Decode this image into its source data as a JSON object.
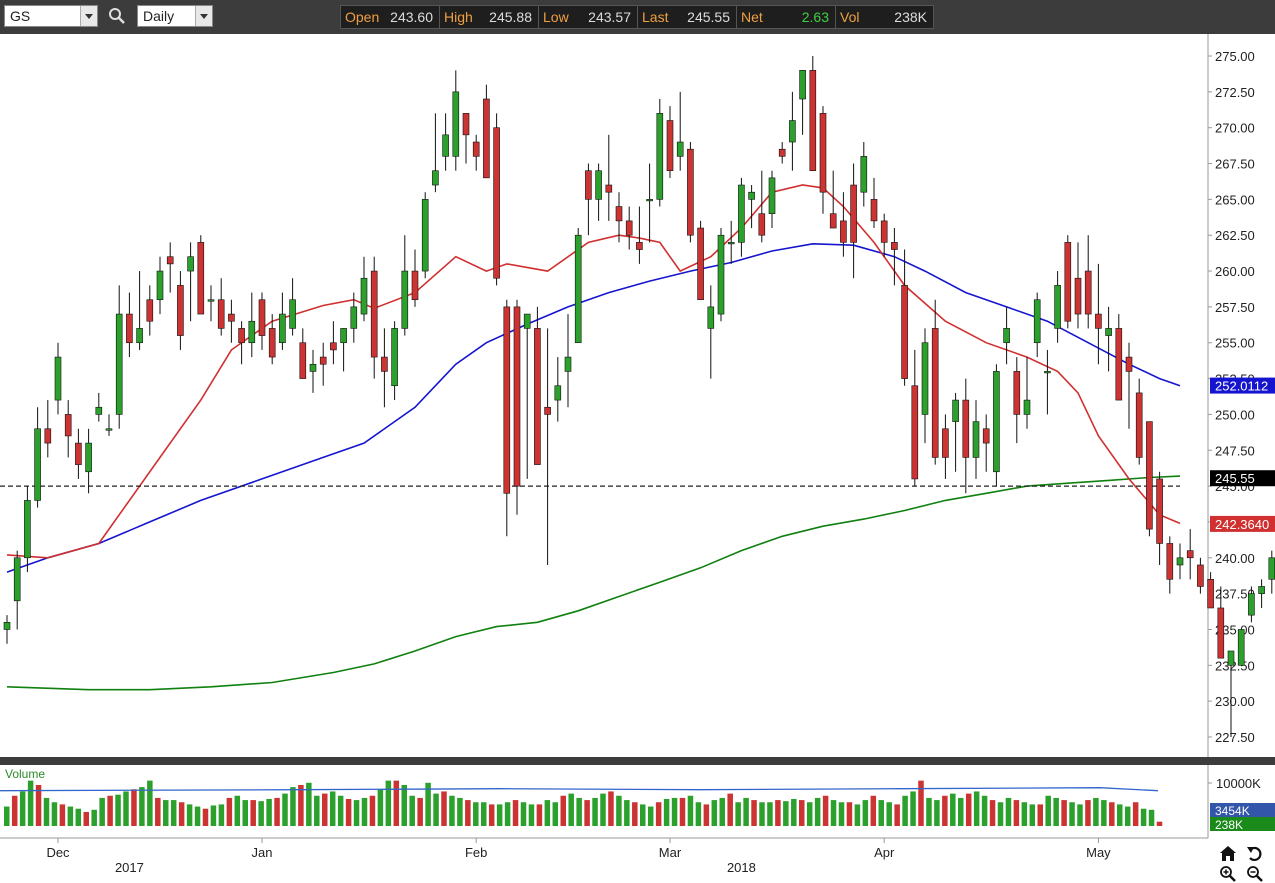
{
  "toolbar": {
    "symbol": "GS",
    "interval": "Daily"
  },
  "quote": {
    "open_label": "Open",
    "open": "243.60",
    "high_label": "High",
    "high": "245.88",
    "low_label": "Low",
    "low": "243.57",
    "last_label": "Last",
    "last": "245.55",
    "net_label": "Net",
    "net": "2.63",
    "vol_label": "Vol",
    "vol": "238K"
  },
  "colors": {
    "up": "#2ca02c",
    "down": "#cc3333",
    "ma_short": "#d03030",
    "ma_mid": "#1515d0",
    "ma_long": "#108010"
  },
  "price_panel": {
    "last_marker": "245.55",
    "ma_blue_marker": "252.0112",
    "ma_red_marker": "242.3640",
    "reference_line": 245.0
  },
  "volume_panel": {
    "title": "Volume",
    "ticks": [
      "10000K"
    ],
    "ma_marker": "3454K",
    "last_marker": "238K"
  },
  "chart_data": {
    "type": "candlestick",
    "y_ticks": [
      "227.50",
      "230.00",
      "232.50",
      "235.00",
      "237.50",
      "240.00",
      "242.50",
      "245.00",
      "247.50",
      "250.00",
      "252.50",
      "255.00",
      "257.50",
      "260.00",
      "262.50",
      "265.00",
      "267.50",
      "270.00",
      "272.50",
      "275.00"
    ],
    "ylim": [
      226,
      276.3
    ],
    "month_labels": [
      {
        "label": "Dec",
        "index": 5
      },
      {
        "label": "Jan",
        "index": 25
      },
      {
        "label": "Feb",
        "index": 46
      },
      {
        "label": "Mar",
        "index": 65
      },
      {
        "label": "Apr",
        "index": 86
      },
      {
        "label": "May",
        "index": 107
      }
    ],
    "year_labels": [
      {
        "label": "2017",
        "index": 12
      },
      {
        "label": "2018",
        "index": 72
      }
    ],
    "candles": [
      [
        235.0,
        236.0,
        234.0,
        235.5
      ],
      [
        237.0,
        240.5,
        235.0,
        240.0
      ],
      [
        240.0,
        245.0,
        239.0,
        244.0
      ],
      [
        244.0,
        250.5,
        243.5,
        249.0
      ],
      [
        249.0,
        251.0,
        247.0,
        248.0
      ],
      [
        251.0,
        255.0,
        250.0,
        254.0
      ],
      [
        250.0,
        251.0,
        247.0,
        248.5
      ],
      [
        248.0,
        249.0,
        245.5,
        246.5
      ],
      [
        246.0,
        249.0,
        244.5,
        248.0
      ],
      [
        250.0,
        251.5,
        249.5,
        250.5
      ],
      [
        249.0,
        250.0,
        248.5,
        249.0
      ],
      [
        250.0,
        259.0,
        249.0,
        257.0
      ],
      [
        257.0,
        258.5,
        254.0,
        255.0
      ],
      [
        255.0,
        260.0,
        254.5,
        256.0
      ],
      [
        258.0,
        259.0,
        255.5,
        256.5
      ],
      [
        258.0,
        261.0,
        257.0,
        260.0
      ],
      [
        261.0,
        262.0,
        258.5,
        260.5
      ],
      [
        259.0,
        260.0,
        254.5,
        255.5
      ],
      [
        260.0,
        262.0,
        256.5,
        261.0
      ],
      [
        262.0,
        262.5,
        258.0,
        257.0
      ],
      [
        258.0,
        259.0,
        256.5,
        258.0
      ],
      [
        258.0,
        259.5,
        255.5,
        256.0
      ],
      [
        257.0,
        258.0,
        255.0,
        256.5
      ],
      [
        256.0,
        256.5,
        253.5,
        255.0
      ],
      [
        255.0,
        258.5,
        254.0,
        256.5
      ],
      [
        258.0,
        258.5,
        254.5,
        255.5
      ],
      [
        256.0,
        257.0,
        253.5,
        254.0
      ],
      [
        255.0,
        258.5,
        254.5,
        257.0
      ],
      [
        256.0,
        259.5,
        255.5,
        258.0
      ],
      [
        255.0,
        256.0,
        252.5,
        252.5
      ],
      [
        253.0,
        254.5,
        251.5,
        253.5
      ],
      [
        254.0,
        255.0,
        252.0,
        253.5
      ],
      [
        255.0,
        256.5,
        253.5,
        254.5
      ],
      [
        255.0,
        256.0,
        253.0,
        256.0
      ],
      [
        256.0,
        258.5,
        255.0,
        257.5
      ],
      [
        257.0,
        261.0,
        256.5,
        259.5
      ],
      [
        260.0,
        261.0,
        252.5,
        254.0
      ],
      [
        254.0,
        256.0,
        250.5,
        253.0
      ],
      [
        252.0,
        256.5,
        251.0,
        256.0
      ],
      [
        256.0,
        262.5,
        255.5,
        260.0
      ],
      [
        260.0,
        261.5,
        257.5,
        258.0
      ],
      [
        260.0,
        265.5,
        259.5,
        265.0
      ],
      [
        266.0,
        271.0,
        265.5,
        267.0
      ],
      [
        268.0,
        271.0,
        267.0,
        269.5
      ],
      [
        268.0,
        274.0,
        267.0,
        272.5
      ],
      [
        271.0,
        271.0,
        267.5,
        269.5
      ],
      [
        269.0,
        269.5,
        267.0,
        268.0
      ],
      [
        272.0,
        273.0,
        266.5,
        266.5
      ],
      [
        270.0,
        271.0,
        259.0,
        259.5
      ],
      [
        257.5,
        258.0,
        241.5,
        244.5
      ],
      [
        257.5,
        258.0,
        243.0,
        245.0
      ],
      [
        256.0,
        257.0,
        245.5,
        257.0
      ],
      [
        256.0,
        257.5,
        250.5,
        246.5
      ],
      [
        250.5,
        256.0,
        239.5,
        250.0
      ],
      [
        251.0,
        254.0,
        249.5,
        252.0
      ],
      [
        253.0,
        257.0,
        250.5,
        254.0
      ],
      [
        255.0,
        263.0,
        255.0,
        262.5
      ],
      [
        267.0,
        267.5,
        262.5,
        265.0
      ],
      [
        265.0,
        267.5,
        263.5,
        267.0
      ],
      [
        266.0,
        269.5,
        263.5,
        265.5
      ],
      [
        264.5,
        265.5,
        262.0,
        263.5
      ],
      [
        263.5,
        264.5,
        261.5,
        262.5
      ],
      [
        262.0,
        264.5,
        260.5,
        261.5
      ],
      [
        265.0,
        267.5,
        262.0,
        265.0
      ],
      [
        265.0,
        272.0,
        264.5,
        271.0
      ],
      [
        270.5,
        271.5,
        266.5,
        267.0
      ],
      [
        268.0,
        272.5,
        267.0,
        269.0
      ],
      [
        268.5,
        269.0,
        262.0,
        262.5
      ],
      [
        263.0,
        263.5,
        259.5,
        258.0
      ],
      [
        256.0,
        259.0,
        252.5,
        257.5
      ],
      [
        257.0,
        263.0,
        256.5,
        262.5
      ],
      [
        262.0,
        263.5,
        260.5,
        262.0
      ],
      [
        262.0,
        266.5,
        261.0,
        266.0
      ],
      [
        265.0,
        266.0,
        263.0,
        265.5
      ],
      [
        264.0,
        267.0,
        262.0,
        262.5
      ],
      [
        264.0,
        267.0,
        263.0,
        266.5
      ],
      [
        268.5,
        269.0,
        267.5,
        268.0
      ],
      [
        269.0,
        272.5,
        267.0,
        270.5
      ],
      [
        272.0,
        274.0,
        269.5,
        274.0
      ],
      [
        274.0,
        275.0,
        269.0,
        267.0
      ],
      [
        271.0,
        271.5,
        264.0,
        265.5
      ],
      [
        264.0,
        267.0,
        263.5,
        263.0
      ],
      [
        263.5,
        265.5,
        261.0,
        262.0
      ],
      [
        266.0,
        267.5,
        259.5,
        262.0
      ],
      [
        265.5,
        269.0,
        264.5,
        268.0
      ],
      [
        265.0,
        266.5,
        263.0,
        263.5
      ],
      [
        263.5,
        264.0,
        261.0,
        262.0
      ],
      [
        262.0,
        263.0,
        259.0,
        261.5
      ],
      [
        259.0,
        261.5,
        252.0,
        252.5
      ],
      [
        252.0,
        254.5,
        245.0,
        245.5
      ],
      [
        250.0,
        256.0,
        248.0,
        255.0
      ],
      [
        256.0,
        258.0,
        246.5,
        247.0
      ],
      [
        249.0,
        250.0,
        245.5,
        247.0
      ],
      [
        249.5,
        251.5,
        246.0,
        251.0
      ],
      [
        251.0,
        252.5,
        244.5,
        247.0
      ],
      [
        247.0,
        251.0,
        245.5,
        249.5
      ],
      [
        249.0,
        250.0,
        246.0,
        248.0
      ],
      [
        246.0,
        253.5,
        245.0,
        253.0
      ],
      [
        255.0,
        257.5,
        253.5,
        256.0
      ],
      [
        253.0,
        254.0,
        248.0,
        250.0
      ],
      [
        250.0,
        254.0,
        249.0,
        251.0
      ],
      [
        255.0,
        258.5,
        254.0,
        258.0
      ],
      [
        253.0,
        254.5,
        250.0,
        253.0
      ],
      [
        256.0,
        260.0,
        255.0,
        259.0
      ],
      [
        262.0,
        262.5,
        256.0,
        256.5
      ],
      [
        259.5,
        262.0,
        256.0,
        257.0
      ],
      [
        260.0,
        262.5,
        256.0,
        257.0
      ],
      [
        257.0,
        260.5,
        253.5,
        256.0
      ],
      [
        255.5,
        257.5,
        253.0,
        256.0
      ],
      [
        256.0,
        257.0,
        251.0,
        251.0
      ],
      [
        254.0,
        255.0,
        249.0,
        253.0
      ],
      [
        251.5,
        252.5,
        246.5,
        247.0
      ],
      [
        249.5,
        249.0,
        241.5,
        242.0
      ],
      [
        245.5,
        246.0,
        239.5,
        241.0
      ],
      [
        241.0,
        241.5,
        237.5,
        238.5
      ],
      [
        239.5,
        241.0,
        238.5,
        240.0
      ],
      [
        240.5,
        242.0,
        238.5,
        240.0
      ],
      [
        239.5,
        240.0,
        237.5,
        238.0
      ],
      [
        238.5,
        239.0,
        237.0,
        236.5
      ],
      [
        236.5,
        238.0,
        233.0,
        233.0
      ],
      [
        232.5,
        233.5,
        227.5,
        233.5
      ],
      [
        232.5,
        235.0,
        232.5,
        235.0
      ],
      [
        236.0,
        238.0,
        235.5,
        237.5
      ],
      [
        237.5,
        238.5,
        236.5,
        238.0
      ],
      [
        238.5,
        240.5,
        237.5,
        240.0
      ],
      [
        240.0,
        242.0,
        239.0,
        242.0
      ],
      [
        242.5,
        243.5,
        241.0,
        243.0
      ],
      [
        243.5,
        244.0,
        241.5,
        243.0
      ],
      [
        243.6,
        245.88,
        243.57,
        245.55
      ]
    ],
    "ma_short": [
      [
        0,
        240.2
      ],
      [
        4,
        240.0
      ],
      [
        9,
        241.0
      ],
      [
        15,
        247.0
      ],
      [
        19,
        251.0
      ],
      [
        22,
        254.5
      ],
      [
        26,
        256.5
      ],
      [
        31,
        257.6
      ],
      [
        34,
        258.0
      ],
      [
        36,
        257.4
      ],
      [
        40,
        258.5
      ],
      [
        44,
        261.0
      ],
      [
        47,
        260.0
      ],
      [
        49,
        260.5
      ],
      [
        53,
        260.0
      ],
      [
        57,
        262.0
      ],
      [
        60,
        262.5
      ],
      [
        62,
        262.3
      ],
      [
        64,
        262.0
      ],
      [
        66,
        260.0
      ],
      [
        69,
        261.0
      ],
      [
        72,
        263.0
      ],
      [
        75,
        265.5
      ],
      [
        78,
        266.0
      ],
      [
        80,
        265.8
      ],
      [
        82,
        264.5
      ],
      [
        85,
        262.0
      ],
      [
        88,
        259.0
      ],
      [
        92,
        256.5
      ],
      [
        96,
        255.0
      ],
      [
        100,
        254.0
      ],
      [
        103,
        253.0
      ],
      [
        105,
        251.5
      ],
      [
        107,
        248.5
      ],
      [
        110,
        245.5
      ],
      [
        113,
        243.0
      ],
      [
        115,
        242.4
      ]
    ],
    "ma_mid": [
      [
        0,
        239.0
      ],
      [
        4,
        240.0
      ],
      [
        9,
        241.0
      ],
      [
        14,
        242.5
      ],
      [
        19,
        244.0
      ],
      [
        25,
        245.5
      ],
      [
        31,
        247.0
      ],
      [
        35,
        248.0
      ],
      [
        40,
        250.5
      ],
      [
        44,
        253.5
      ],
      [
        47,
        255.0
      ],
      [
        51,
        256.3
      ],
      [
        55,
        257.5
      ],
      [
        59,
        258.5
      ],
      [
        63,
        259.3
      ],
      [
        67,
        260.0
      ],
      [
        71,
        260.6
      ],
      [
        75,
        261.4
      ],
      [
        79,
        261.9
      ],
      [
        83,
        261.8
      ],
      [
        87,
        261.0
      ],
      [
        90,
        260.0
      ],
      [
        94,
        258.5
      ],
      [
        98,
        257.5
      ],
      [
        102,
        256.5
      ],
      [
        106,
        255.0
      ],
      [
        110,
        253.5
      ],
      [
        113,
        252.5
      ],
      [
        115,
        252.0
      ]
    ],
    "ma_long": [
      [
        0,
        231.0
      ],
      [
        8,
        230.8
      ],
      [
        14,
        230.8
      ],
      [
        20,
        231.0
      ],
      [
        26,
        231.3
      ],
      [
        32,
        232.0
      ],
      [
        36,
        232.6
      ],
      [
        40,
        233.5
      ],
      [
        44,
        234.5
      ],
      [
        48,
        235.2
      ],
      [
        52,
        235.5
      ],
      [
        56,
        236.3
      ],
      [
        60,
        237.3
      ],
      [
        64,
        238.3
      ],
      [
        68,
        239.3
      ],
      [
        72,
        240.5
      ],
      [
        76,
        241.5
      ],
      [
        80,
        242.2
      ],
      [
        84,
        242.7
      ],
      [
        88,
        243.3
      ],
      [
        92,
        244.0
      ],
      [
        96,
        244.5
      ],
      [
        100,
        245.0
      ],
      [
        104,
        245.2
      ],
      [
        108,
        245.4
      ],
      [
        112,
        245.6
      ],
      [
        115,
        245.7
      ]
    ],
    "volume": {
      "values": [
        1800,
        2800,
        3200,
        4200,
        3800,
        2600,
        2200,
        2000,
        1800,
        1600,
        1300,
        1500,
        2600,
        2800,
        2900,
        3200,
        3400,
        3600,
        4200,
        2600,
        2400,
        2400,
        2200,
        2000,
        1800,
        1600,
        1900,
        2000,
        2600,
        2800,
        2400,
        2400,
        2300,
        2500,
        2600,
        3000,
        3600,
        3800,
        4000,
        2800,
        3000,
        3200,
        2800,
        2500,
        2400,
        2600,
        2800,
        3400,
        4200,
        4200,
        3800,
        2800,
        2600,
        4000,
        3000,
        3200,
        2800,
        2600,
        2400,
        2200,
        2200,
        2000,
        2000,
        2200,
        2400,
        2200,
        2000,
        2000,
        2400,
        2200,
        2800,
        3000,
        2600,
        2400,
        2600,
        3000,
        3200,
        2800,
        2400,
        2200,
        2000,
        1800,
        2200,
        2500,
        2600,
        2600,
        2800,
        2200,
        2000,
        2400,
        2600,
        3000,
        2200,
        2600,
        2400,
        2200,
        2200,
        2400,
        2300,
        2500,
        2400,
        2200,
        2600,
        2800,
        2400,
        2200,
        2200,
        2000,
        2400,
        2800,
        2400,
        2200,
        2000,
        2800,
        3200,
        4200,
        2600,
        2400,
        2800,
        3000,
        2600,
        3000,
        3200,
        2800,
        2400,
        2200,
        2600,
        2400,
        2200,
        2000,
        2000,
        2800,
        2600,
        2400,
        2200,
        2000,
        2400,
        2600,
        2400,
        2200,
        2000,
        1800,
        2200,
        1600,
        1500,
        400
      ],
      "ma": 3454
    }
  }
}
